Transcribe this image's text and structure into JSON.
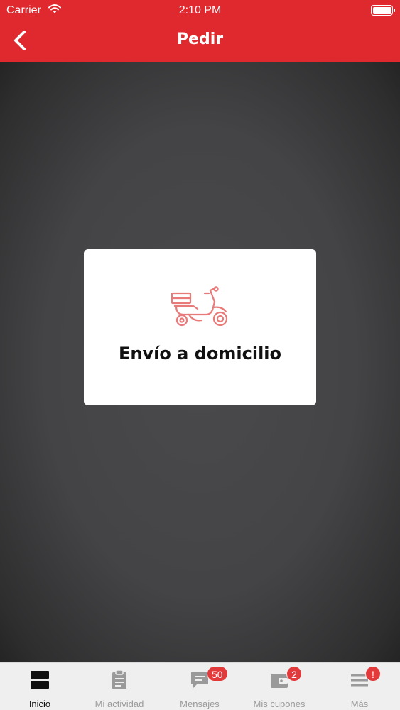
{
  "status_bar": {
    "carrier": "Carrier",
    "time": "2:10 PM"
  },
  "header": {
    "title": "Pedir"
  },
  "card": {
    "label": "Envío a domicilio",
    "icon": "scooter-icon"
  },
  "tabs": [
    {
      "label": "Inicio",
      "icon": "home-grid-icon",
      "active": true
    },
    {
      "label": "Mi actividad",
      "icon": "clipboard-icon"
    },
    {
      "label": "Mensajes",
      "icon": "chat-icon",
      "badge": "50"
    },
    {
      "label": "Mis cupones",
      "icon": "wallet-icon",
      "badge": "2"
    },
    {
      "label": "Más",
      "icon": "menu-icon",
      "badge": "!"
    }
  ],
  "colors": {
    "brand": "#e0292f",
    "badge": "#e23a3a",
    "icon_accent": "#e87a7a"
  }
}
